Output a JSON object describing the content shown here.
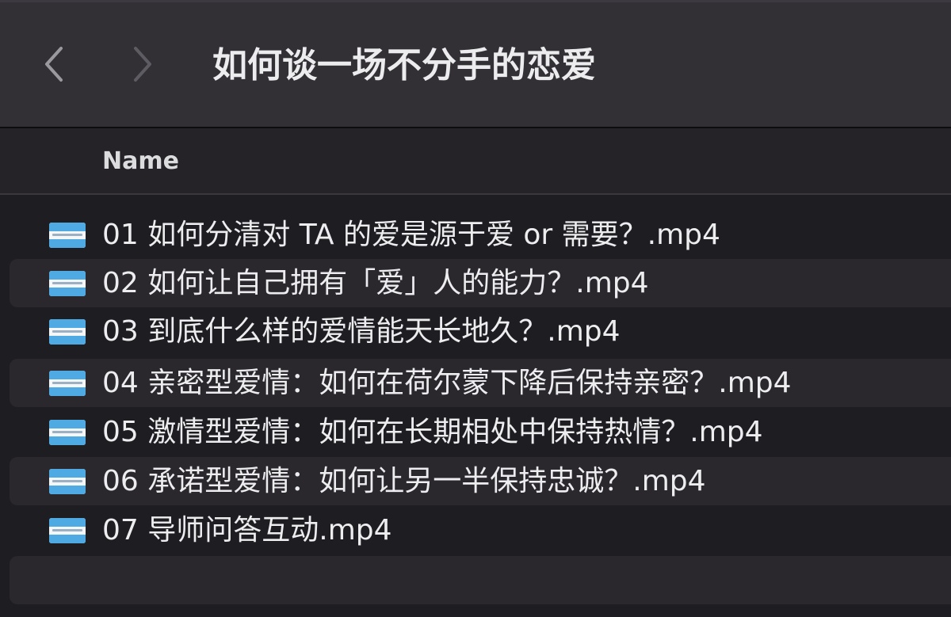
{
  "toolbar": {
    "back_icon": "chevron-left-icon",
    "forward_icon": "chevron-right-icon",
    "title": "如何谈一场不分手的恋爱"
  },
  "list_header": {
    "name_column": "Name"
  },
  "files": [
    {
      "name": "01 如何分清对 TA 的爱是源于爱 or 需要？.mp4",
      "icon": "video-file-icon"
    },
    {
      "name": "02 如何让自己拥有「爱」人的能力？.mp4",
      "icon": "video-file-icon"
    },
    {
      "name": "03 到底什么样的爱情能天长地久？.mp4",
      "icon": "video-file-icon"
    },
    {
      "name": "04 亲密型爱情：如何在荷尔蒙下降后保持亲密？.mp4",
      "icon": "video-file-icon"
    },
    {
      "name": "05 激情型爱情：如何在长期相处中保持热情？.mp4",
      "icon": "video-file-icon"
    },
    {
      "name": "06 承诺型爱情：如何让另一半保持忠诚？.mp4",
      "icon": "video-file-icon"
    },
    {
      "name": "07 导师问答互动.mp4",
      "icon": "video-file-icon"
    }
  ],
  "colors": {
    "background": "#1e1d21",
    "toolbar": "#322f35",
    "alt_row": "#2a282d",
    "icon_blue": "#4fa9e3"
  }
}
